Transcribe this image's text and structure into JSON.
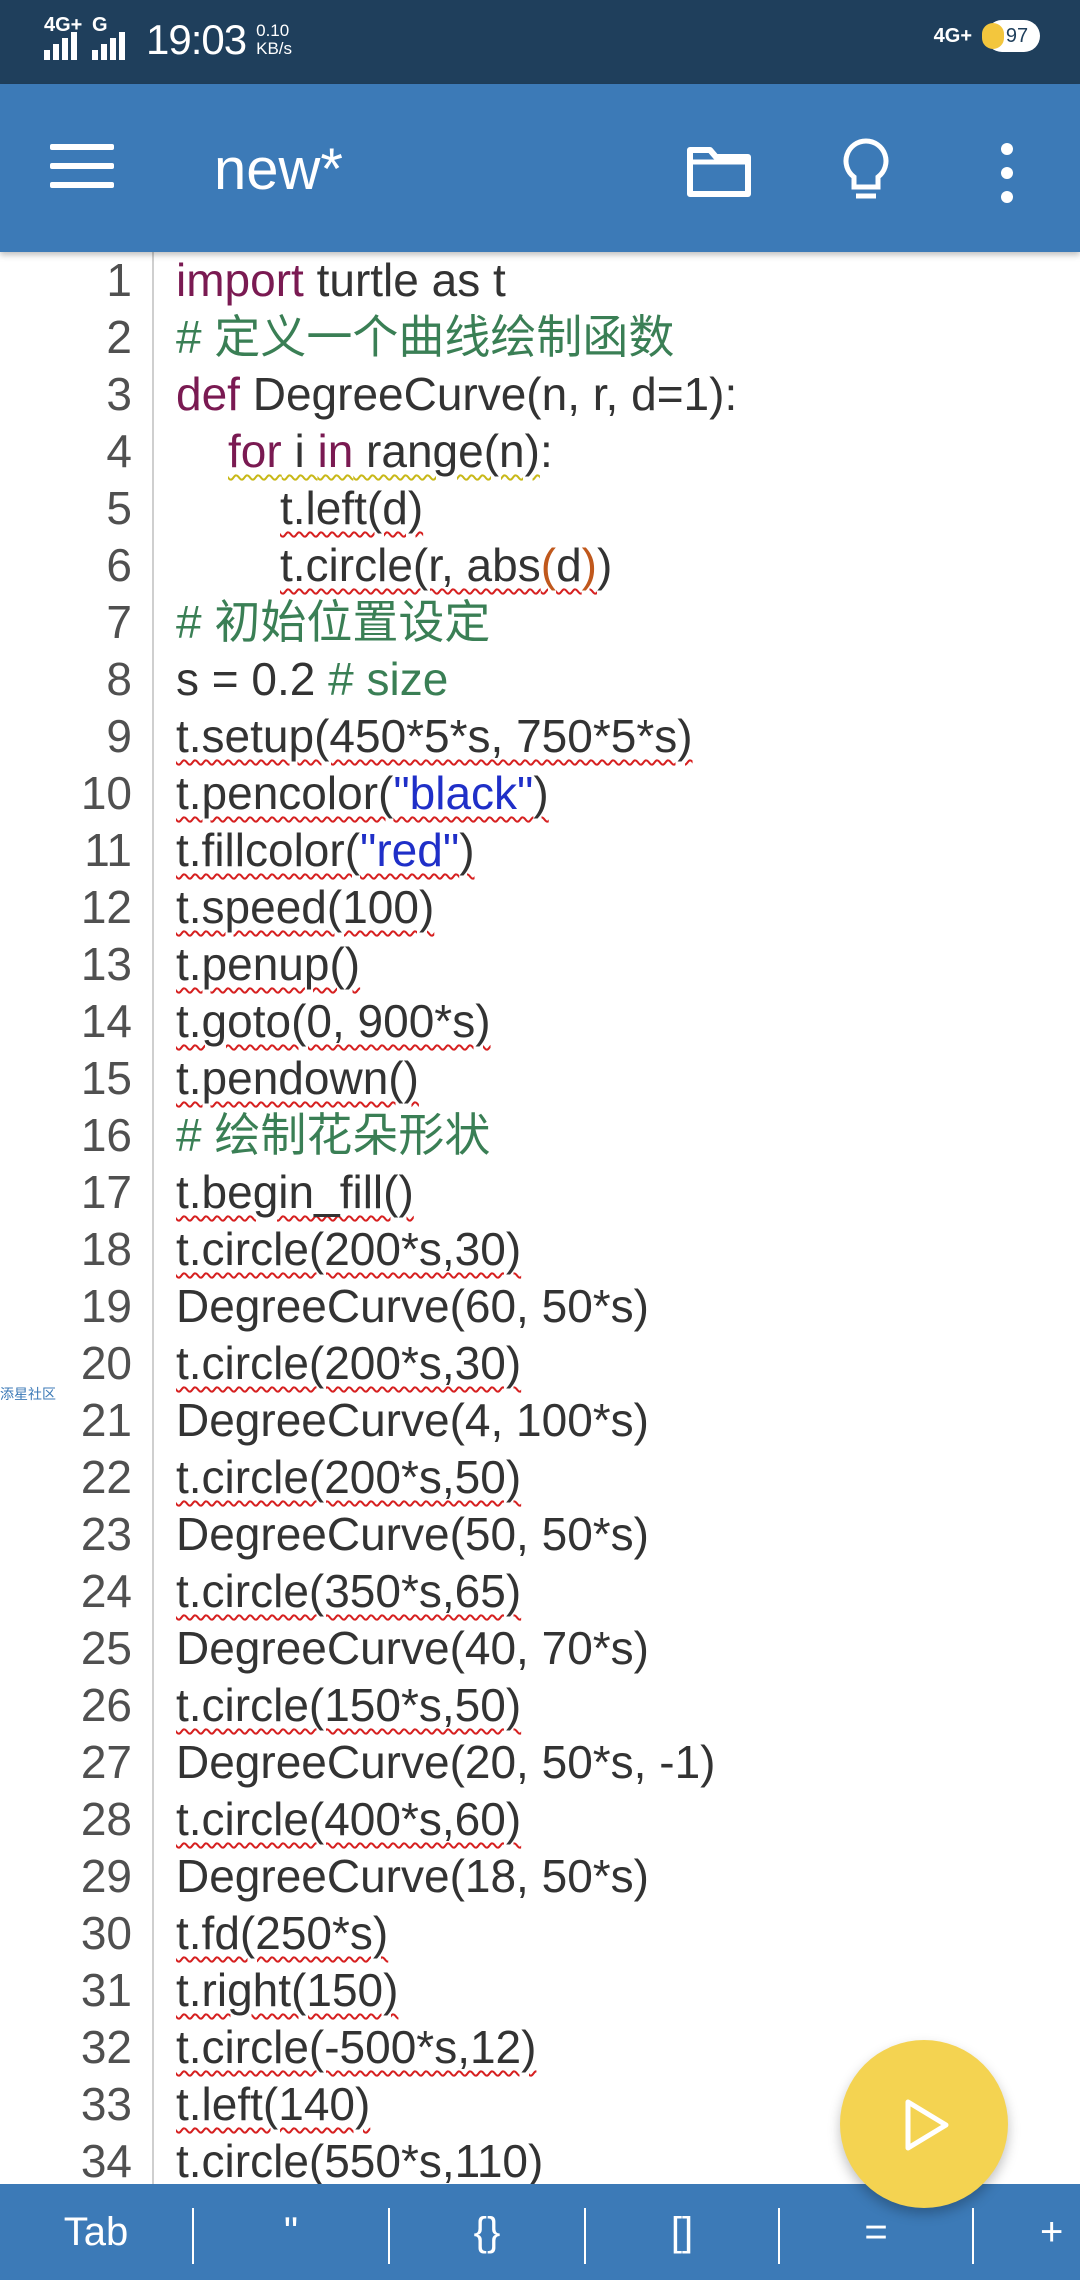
{
  "status_bar": {
    "network1": "4G+",
    "network2": "G",
    "time": "19:03",
    "speed_value": "0.10",
    "speed_unit": "KB/s",
    "network_right": "4G+",
    "battery": "97"
  },
  "app_bar": {
    "title": "new*",
    "menu_icon": "hamburger-menu-icon",
    "folder_icon": "folder-icon",
    "idea_icon": "lightbulb-icon",
    "more_icon": "more-vert-icon"
  },
  "editor": {
    "side_tag": "添星社区",
    "lines": [
      {
        "n": "1",
        "text": "import turtle as t"
      },
      {
        "n": "2",
        "text": "# 定义一个曲线绘制函数"
      },
      {
        "n": "3",
        "text": "def DegreeCurve(n, r, d=1):"
      },
      {
        "n": "4",
        "text": "for i in range(n):"
      },
      {
        "n": "5",
        "text": "t.left(d)"
      },
      {
        "n": "6",
        "text": "t.circle(r, abs(d))"
      },
      {
        "n": "7",
        "text": "# 初始位置设定"
      },
      {
        "n": "8",
        "text": "s = 0.2 # size"
      },
      {
        "n": "9",
        "text": "t.setup(450*5*s, 750*5*s)"
      },
      {
        "n": "10",
        "text": "t.pencolor(\"black\")"
      },
      {
        "n": "11",
        "text": "t.fillcolor(\"red\")"
      },
      {
        "n": "12",
        "text": "t.speed(100)"
      },
      {
        "n": "13",
        "text": "t.penup()"
      },
      {
        "n": "14",
        "text": "t.goto(0, 900*s)"
      },
      {
        "n": "15",
        "text": "t.pendown()"
      },
      {
        "n": "16",
        "text": "# 绘制花朵形状"
      },
      {
        "n": "17",
        "text": "t.begin_fill()"
      },
      {
        "n": "18",
        "text": "t.circle(200*s,30)"
      },
      {
        "n": "19",
        "text": "DegreeCurve(60, 50*s)"
      },
      {
        "n": "20",
        "text": "t.circle(200*s,30)"
      },
      {
        "n": "21",
        "text": "DegreeCurve(4, 100*s)"
      },
      {
        "n": "22",
        "text": "t.circle(200*s,50)"
      },
      {
        "n": "23",
        "text": "DegreeCurve(50, 50*s)"
      },
      {
        "n": "24",
        "text": "t.circle(350*s,65)"
      },
      {
        "n": "25",
        "text": "DegreeCurve(40, 70*s)"
      },
      {
        "n": "26",
        "text": "t.circle(150*s,50)"
      },
      {
        "n": "27",
        "text": "DegreeCurve(20, 50*s, -1)"
      },
      {
        "n": "28",
        "text": "t.circle(400*s,60)"
      },
      {
        "n": "29",
        "text": "DegreeCurve(18, 50*s)"
      },
      {
        "n": "30",
        "text": "t.fd(250*s)"
      },
      {
        "n": "31",
        "text": "t.right(150)"
      },
      {
        "n": "32",
        "text": "t.circle(-500*s,12)"
      },
      {
        "n": "33",
        "text": "t.left(140)"
      },
      {
        "n": "34",
        "text": "t.circle(550*s,110)"
      }
    ]
  },
  "fab": {
    "icon": "play-icon"
  },
  "toolbar": {
    "keys": [
      "Tab",
      "\"",
      "{}",
      "[]",
      "=",
      "+"
    ]
  },
  "colors": {
    "status_bar": "#1f3f5c",
    "app_bar": "#3c7ab7",
    "keyword": "#7a1a52",
    "comment": "#3a7f55",
    "string": "#1f2fc8",
    "fab": "#f4d351"
  }
}
